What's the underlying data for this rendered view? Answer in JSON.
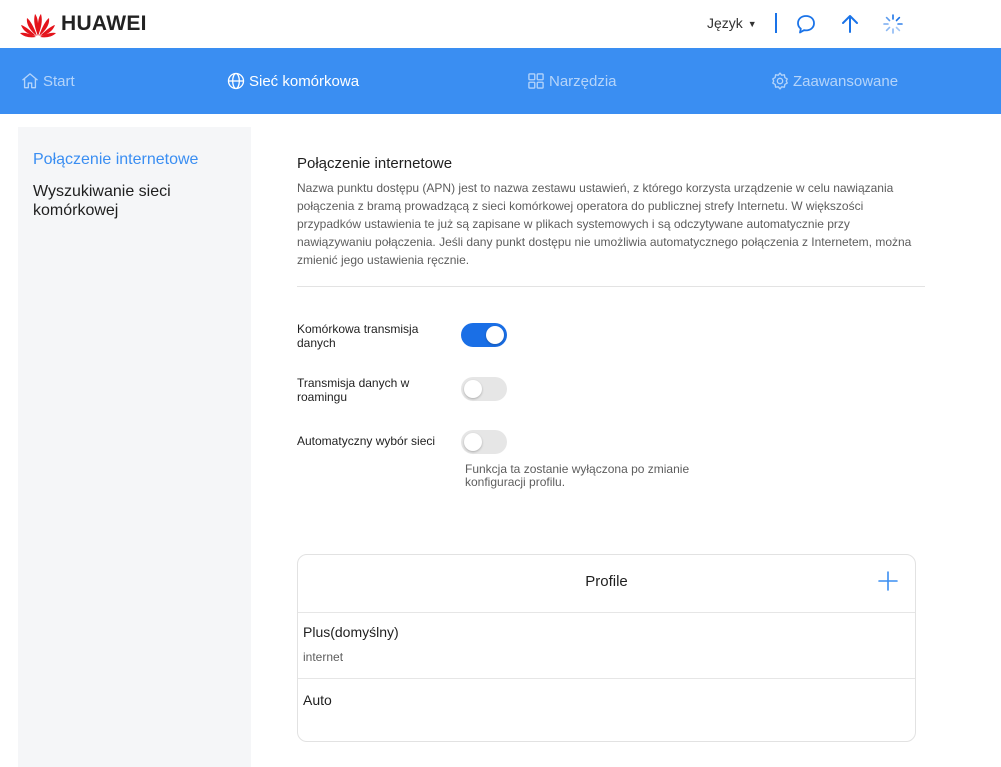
{
  "header": {
    "brand": "HUAWEI",
    "language_label": "Język",
    "icons": [
      "chat-icon",
      "arrow-up-icon",
      "loading-spinner-icon"
    ]
  },
  "nav": {
    "items": [
      {
        "label": "Start",
        "icon": "home-icon",
        "active": false
      },
      {
        "label": "Sieć komórkowa",
        "icon": "globe-icon",
        "active": true
      },
      {
        "label": "Narzędzia",
        "icon": "grid-icon",
        "active": false
      },
      {
        "label": "Zaawansowane",
        "icon": "gear-icon",
        "active": false
      }
    ]
  },
  "sidebar": {
    "items": [
      {
        "label": "Połączenie internetowe",
        "active": true
      },
      {
        "label": "Wyszukiwanie sieci komórkowej",
        "active": false
      }
    ]
  },
  "main": {
    "title": "Połączenie internetowe",
    "description": "Nazwa punktu dostępu (APN) jest to nazwa zestawu ustawień, z którego korzysta urządzenie w celu nawiązania połączenia z bramą prowadzącą z sieci komórkowej operatora do publicznej strefy Internetu. W większości przypadków ustawienia te już są zapisane w plikach systemowych i są odczytywane automatycznie przy nawiązywaniu połączenia. Jeśli dany punkt dostępu nie umożliwia automatycznego połączenia z Internetem, można zmienić jego ustawienia ręcznie.",
    "settings": [
      {
        "label": "Komórkowa transmisja danych",
        "enabled": true
      },
      {
        "label": "Transmisja danych w roamingu",
        "enabled": false
      },
      {
        "label": "Automatyczny wybór sieci",
        "enabled": false
      }
    ],
    "auto_network_hint": "Funkcja ta zostanie wyłączona po zmianie konfiguracji profilu."
  },
  "profiles": {
    "title": "Profile",
    "items": [
      {
        "name": "Plus(domyślny)",
        "apn": "internet"
      },
      {
        "name": "Auto",
        "apn": ""
      }
    ]
  },
  "colors": {
    "accent": "#3a8ef2",
    "toggle_on": "#1a6fe6",
    "toggle_off": "#e6e6e6"
  }
}
